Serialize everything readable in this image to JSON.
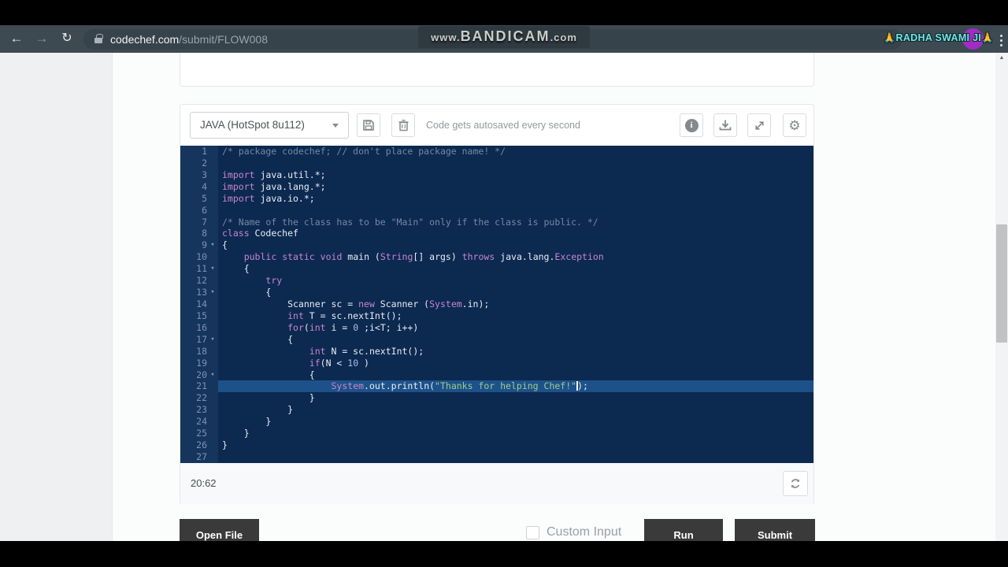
{
  "browser": {
    "back_glyph": "←",
    "forward_glyph": "→",
    "reload_glyph": "↻",
    "url_domain": "codechef.com",
    "url_path": "/submit/FLOW008",
    "watermark": {
      "pre": "www.",
      "main": "BANDICAM",
      "post": ".com"
    },
    "profile_name": "🙏RADHA SWAMI JI🙏"
  },
  "scrollbar": {
    "up_glyph": "▲"
  },
  "toolbar": {
    "language_selected": "JAVA (HotSpot 8u112)",
    "autosave_note": "Code gets autosaved every second",
    "info_glyph": "i",
    "gear_glyph": "⚙"
  },
  "editor": {
    "fold_glyph": "▾",
    "cursor_position": "20:62",
    "lines": [
      {
        "n": 1,
        "t": [
          [
            "/* package codechef; // don't place package name! */",
            "c"
          ]
        ]
      },
      {
        "n": 2,
        "t": []
      },
      {
        "n": 3,
        "t": [
          [
            "import",
            "k"
          ],
          [
            " java.util.*;",
            "p"
          ]
        ]
      },
      {
        "n": 4,
        "t": [
          [
            "import",
            "k"
          ],
          [
            " java.lang.*;",
            "p"
          ]
        ]
      },
      {
        "n": 5,
        "t": [
          [
            "import",
            "k"
          ],
          [
            " java.io.*;",
            "p"
          ]
        ]
      },
      {
        "n": 6,
        "t": []
      },
      {
        "n": 7,
        "t": [
          [
            "/* Name of the class has to be \"Main\" only if the class is public. */",
            "c"
          ]
        ]
      },
      {
        "n": 8,
        "t": [
          [
            "class",
            "k"
          ],
          [
            " Codechef",
            "p"
          ]
        ]
      },
      {
        "n": 9,
        "fold": true,
        "t": [
          [
            "{",
            "p"
          ]
        ]
      },
      {
        "n": 10,
        "t": [
          [
            "    ",
            "p"
          ],
          [
            "public",
            "k"
          ],
          [
            " ",
            "p"
          ],
          [
            "static",
            "k"
          ],
          [
            " ",
            "p"
          ],
          [
            "void",
            "k"
          ],
          [
            " main (",
            "p"
          ],
          [
            "String",
            "k"
          ],
          [
            "[] args) ",
            "p"
          ],
          [
            "throws",
            "k"
          ],
          [
            " java.lang.",
            "p"
          ],
          [
            "Exception",
            "k"
          ]
        ]
      },
      {
        "n": 11,
        "fold": true,
        "t": [
          [
            "    {",
            "p"
          ]
        ]
      },
      {
        "n": 12,
        "t": [
          [
            "        ",
            "p"
          ],
          [
            "try",
            "k"
          ]
        ]
      },
      {
        "n": 13,
        "fold": true,
        "t": [
          [
            "        {",
            "p"
          ]
        ]
      },
      {
        "n": 14,
        "t": [
          [
            "            Scanner sc = ",
            "p"
          ],
          [
            "new",
            "k"
          ],
          [
            " Scanner (",
            "p"
          ],
          [
            "System",
            "k"
          ],
          [
            ".in);",
            "p"
          ]
        ]
      },
      {
        "n": 15,
        "t": [
          [
            "            ",
            "p"
          ],
          [
            "int",
            "k"
          ],
          [
            " T = sc.nextInt();",
            "p"
          ]
        ]
      },
      {
        "n": 16,
        "t": [
          [
            "            ",
            "p"
          ],
          [
            "for",
            "k"
          ],
          [
            "(",
            "p"
          ],
          [
            "int",
            "k"
          ],
          [
            " i = ",
            "p"
          ],
          [
            "0",
            "n"
          ],
          [
            " ;i<T; i++)",
            "p"
          ]
        ]
      },
      {
        "n": 17,
        "fold": true,
        "t": [
          [
            "            {",
            "p"
          ]
        ]
      },
      {
        "n": 18,
        "t": [
          [
            "                ",
            "p"
          ],
          [
            "int",
            "k"
          ],
          [
            " N = sc.nextInt();",
            "p"
          ]
        ]
      },
      {
        "n": 19,
        "t": [
          [
            "                ",
            "p"
          ],
          [
            "if",
            "k"
          ],
          [
            "(N < ",
            "p"
          ],
          [
            "10",
            "n"
          ],
          [
            " )",
            "p"
          ]
        ]
      },
      {
        "n": 20,
        "fold": true,
        "t": [
          [
            "                {",
            "p"
          ]
        ]
      },
      {
        "n": 21,
        "hl": true,
        "t": [
          [
            "                    ",
            "p"
          ],
          [
            "System",
            "k"
          ],
          [
            ".out.println(",
            "p"
          ],
          [
            "\"Thanks for helping Chef!\"",
            "s"
          ],
          [
            "",
            "cur"
          ],
          [
            ");",
            "p"
          ]
        ]
      },
      {
        "n": 22,
        "t": [
          [
            "                }",
            "p"
          ]
        ]
      },
      {
        "n": 23,
        "t": [
          [
            "            }",
            "p"
          ]
        ]
      },
      {
        "n": 24,
        "t": [
          [
            "        }",
            "p"
          ]
        ]
      },
      {
        "n": 25,
        "t": [
          [
            "    }",
            "p"
          ]
        ]
      },
      {
        "n": 26,
        "t": [
          [
            "}",
            "p"
          ]
        ]
      },
      {
        "n": 27,
        "t": []
      }
    ]
  },
  "footer": {
    "open_file_label": "Open File",
    "custom_input_label": "Custom Input",
    "run_label": "Run",
    "submit_label": "Submit"
  },
  "colors": {
    "editor_background": "#0c2950",
    "editor_gutter": "#15355d",
    "active_line_highlight": "#1d5189",
    "keyword": "#c886ca",
    "comment": "#7688a3",
    "string": "#9fcb8d",
    "number": "#a9bfe8",
    "plain_text": "#e9eef5",
    "browser_chrome": "#3d4a52",
    "dark_button": "#3a3a3a",
    "profile_text": "#6fe6e1",
    "avatar_purple": "#a02cc4"
  }
}
